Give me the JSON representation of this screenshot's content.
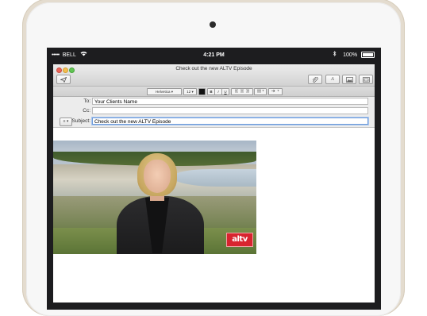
{
  "status_bar": {
    "signal_dots": "•••••",
    "carrier": "BELL",
    "time": "4:21 PM",
    "battery_pct": "100%"
  },
  "window": {
    "title": "Check out the new ALTV Episode"
  },
  "format_bar": {
    "font": "Helvetica",
    "size": "12",
    "bold": "B",
    "italic": "I",
    "underline": "U"
  },
  "headers": {
    "to_label": "To:",
    "to_value": "Your Clients Name",
    "cc_label": "Cc:",
    "cc_value": "",
    "subject_label": "Subject:",
    "subject_value": "Check out the new ALTV Episode"
  },
  "video": {
    "logo_text": "altv"
  }
}
